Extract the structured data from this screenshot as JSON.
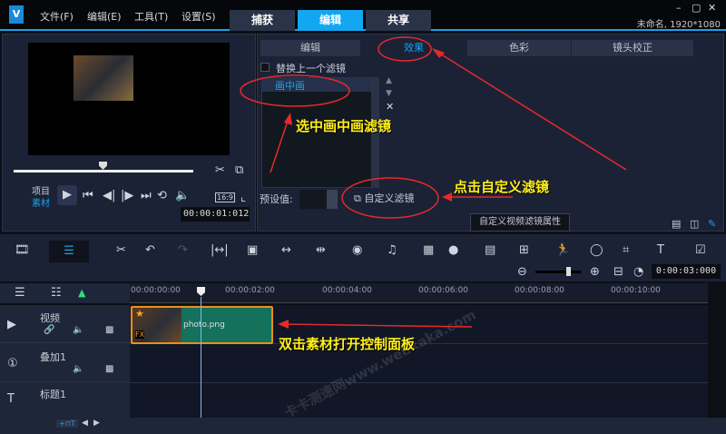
{
  "app": {
    "logo": "V",
    "menu": [
      "文件(F)",
      "编辑(E)",
      "工具(T)",
      "设置(S)"
    ],
    "main_tabs": [
      "捕获",
      "编辑",
      "共享"
    ],
    "active_tab": "编辑",
    "project_info": "未命名, 1920*1080",
    "window_controls": [
      "minimize-icon",
      "maximize-icon",
      "close-icon"
    ]
  },
  "player": {
    "mode_project": "项目",
    "mode_clip": "素材",
    "timecode": "00:00:01:012",
    "aspect": "16:9"
  },
  "effects": {
    "tabs": [
      "编辑",
      "效果",
      "色彩",
      "镜头校正"
    ],
    "active_tab": "效果",
    "replace_label": "替换上一个滤镜",
    "filters": [
      "画中画"
    ],
    "preset_label": "预设值:",
    "custom_filter_label": "自定义滤镜",
    "tooltip": "自定义视频滤镜属性"
  },
  "timeline": {
    "zoom_time": "0:00:03:000",
    "ruler": [
      "00:00:00:00",
      "00:00:02:00",
      "00:00:04:00",
      "00:00:06:00",
      "00:00:08:00",
      "00:00:10:00"
    ],
    "tracks": [
      {
        "name": "视频"
      },
      {
        "name": "叠加1"
      },
      {
        "name": "标题1"
      }
    ],
    "clip": {
      "name": "photo.png",
      "badge": "FX"
    }
  },
  "annotations": [
    "选中画中画滤镜",
    "点击自定义滤镜",
    "双击素材打开控制面板"
  ],
  "watermark": "卡卡测速网www.webkaka.com",
  "colors": {
    "accent": "#1aa3e8",
    "clip": "#13715c",
    "annotation_text": "#ffef1a",
    "annotation_line": "#e8282a"
  }
}
